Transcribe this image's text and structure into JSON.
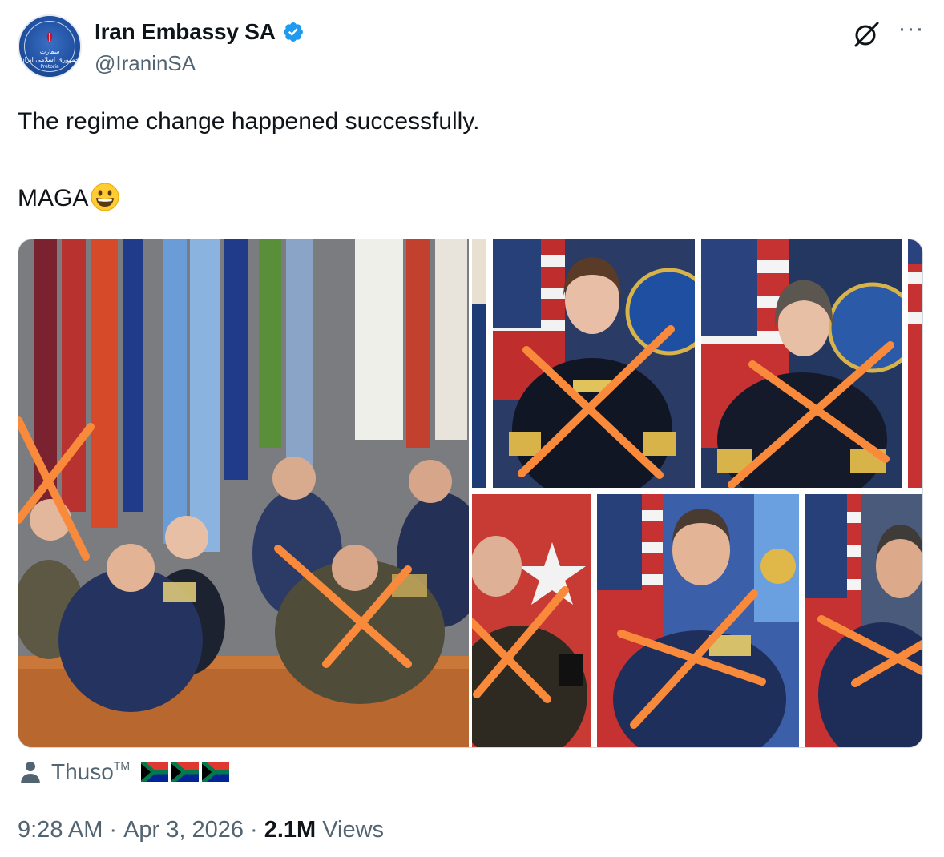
{
  "account": {
    "display_name": "Iran Embassy SA",
    "handle": "@IraninSA",
    "verified": true,
    "avatar_icon": "embassy-seal-icon"
  },
  "tweet": {
    "line1": "The regime change happened successfully.",
    "line2": "MAGA",
    "emoji": "grinning-face-icon"
  },
  "media": {
    "image_count": 7,
    "overlay_mark": "orange-x",
    "accent_color": "#f98a3b"
  },
  "tag": {
    "name": "Thuso",
    "tm": "TM",
    "flags": [
      "south-africa-flag-icon",
      "south-africa-flag-icon",
      "south-africa-flag-icon"
    ]
  },
  "meta": {
    "time": "9:28 AM",
    "date": "Apr 3, 2026",
    "separator": "·",
    "views_count": "2.1M",
    "views_label": "Views"
  },
  "colors": {
    "text_primary": "#0f1419",
    "text_secondary": "#536471",
    "verified_blue": "#1d9bf0",
    "border": "#cfd9de"
  }
}
